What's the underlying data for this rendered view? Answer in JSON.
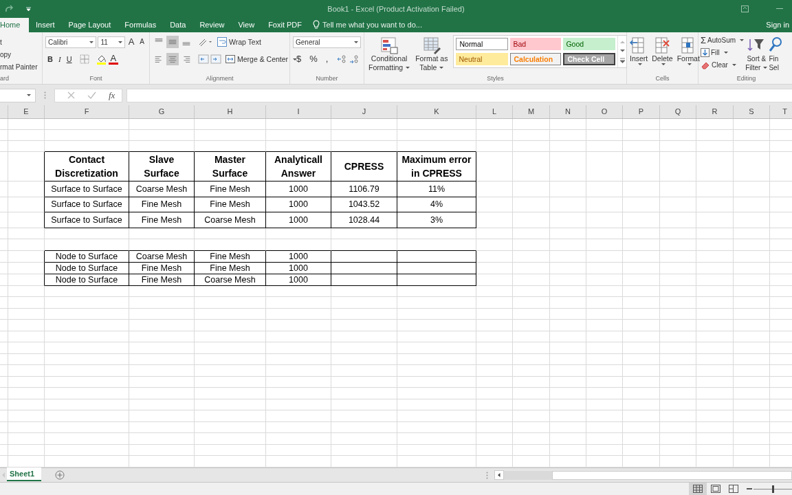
{
  "window": {
    "title": "Book1 - Excel (Product Activation Failed)"
  },
  "ribbon_tabs": [
    {
      "label": "Home",
      "selected": true
    },
    {
      "label": "Insert",
      "selected": false
    },
    {
      "label": "Page Layout",
      "selected": false
    },
    {
      "label": "Formulas",
      "selected": false
    },
    {
      "label": "Data",
      "selected": false
    },
    {
      "label": "Review",
      "selected": false
    },
    {
      "label": "View",
      "selected": false
    },
    {
      "label": "Foxit PDF",
      "selected": false
    }
  ],
  "tell_me": {
    "placeholder": "Tell me what you want to do..."
  },
  "sign_in": "Sign in",
  "ribbon": {
    "clipboard": {
      "items": [
        "t",
        "opy",
        "rmat Painter"
      ],
      "label": "ard"
    },
    "font": {
      "name": "Calibri",
      "size": "11",
      "grow": "A",
      "shrink": "A",
      "styles": [
        "B",
        "I",
        "U"
      ],
      "font_color": "A",
      "label": "Font"
    },
    "alignment": {
      "wrap": "Wrap Text",
      "merge": "Merge & Center",
      "label": "Alignment"
    },
    "number": {
      "format": "General",
      "symbols": [
        "$",
        "%",
        ","
      ],
      "label": "Number"
    },
    "styles": {
      "conditional": [
        "Conditional",
        "Formatting"
      ],
      "format_table": [
        "Format as",
        "Table"
      ],
      "gallery": [
        {
          "label": "Normal",
          "kind": "normal"
        },
        {
          "label": "Bad",
          "kind": "bad"
        },
        {
          "label": "Good",
          "kind": "good"
        },
        {
          "label": "Neutral",
          "kind": "neutral"
        },
        {
          "label": "Calculation",
          "kind": "calculation"
        },
        {
          "label": "Check Cell",
          "kind": "check"
        }
      ],
      "label": "Styles"
    },
    "cells": {
      "buttons": [
        "Insert",
        "Delete",
        "Format"
      ],
      "label": "Cells"
    },
    "editing": {
      "autosum_sign": "Σ",
      "items": [
        "AutoSum",
        "Fill",
        "Clear"
      ],
      "sort": [
        "Sort &",
        "Filter"
      ],
      "find": [
        "Fin",
        "Sel"
      ],
      "label": "Editing"
    }
  },
  "formula_bar": {
    "fx": "fx"
  },
  "sheet": {
    "columns": [
      "E",
      "F",
      "G",
      "H",
      "I",
      "J",
      "K",
      "L",
      "M",
      "N",
      "O",
      "P",
      "Q",
      "R",
      "S",
      "T"
    ],
    "tables": [
      {
        "header": [
          "Contact Discretization",
          "Slave Surface",
          "Master Surface",
          "Analyticall Answer",
          "CPRESS",
          "Maximum error in CPRESS"
        ],
        "rows": [
          [
            "Surface to Surface",
            "Coarse Mesh",
            "Fine Mesh",
            "1000",
            "1106.79",
            "11%"
          ],
          [
            "Surface to Surface",
            "Fine Mesh",
            "Fine Mesh",
            "1000",
            "1043.52",
            "4%"
          ],
          [
            "Surface to Surface",
            "Fine Mesh",
            "Coarse Mesh",
            "1000",
            "1028.44",
            "3%"
          ]
        ]
      },
      {
        "rows": [
          [
            "Node to Surface",
            "Coarse Mesh",
            "Fine Mesh",
            "1000",
            "",
            ""
          ],
          [
            "Node to Surface",
            "Fine Mesh",
            "Fine Mesh",
            "1000",
            "",
            ""
          ],
          [
            "Node to Surface",
            "Fine Mesh",
            "Coarse Mesh",
            "1000",
            "",
            ""
          ]
        ]
      }
    ]
  },
  "sheet_tabs": [
    {
      "label": "Sheet1",
      "selected": true
    }
  ],
  "status_bar": {
    "views": [
      {
        "kind": "normal",
        "selected": true
      },
      {
        "kind": "page_layout",
        "selected": false
      },
      {
        "kind": "page_break",
        "selected": false
      }
    ],
    "zoom": {
      "level": 0.5
    }
  }
}
